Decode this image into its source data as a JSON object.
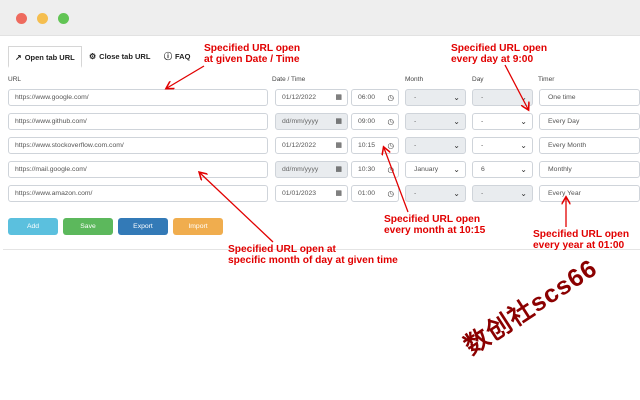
{
  "window": {
    "traffic_lights": [
      "#ee6a5e",
      "#f5be4f",
      "#61c454"
    ]
  },
  "tabs": [
    {
      "label": "Open tab URL",
      "icon": "external-link-icon",
      "active": true
    },
    {
      "label": "Close tab URL",
      "icon": "gear-icon",
      "active": false
    },
    {
      "label": "FAQ",
      "icon": "question-circle-icon",
      "active": false
    }
  ],
  "columns": {
    "url": "URL",
    "datetime": "Date / Time",
    "month": "Month",
    "day": "Day",
    "timer": "Timer"
  },
  "rows": [
    {
      "url": "https://www.google.com/",
      "date": "01/12/2022",
      "time": "06:00",
      "month": "-",
      "day": "-",
      "timer": "One time"
    },
    {
      "url": "https://www.github.com/",
      "date": "dd/mm/yyyy",
      "time": "09:00",
      "month": "-",
      "day": "-",
      "timer": "Every Day"
    },
    {
      "url": "https://www.stockoverflow.com.com/",
      "date": "01/12/2022",
      "time": "10:15",
      "month": "-",
      "day": "-",
      "timer": "Every Month"
    },
    {
      "url": "https://mail.google.com/",
      "date": "dd/mm/yyyy",
      "time": "10:30",
      "month": "January",
      "day": "6",
      "timer": "Monthly"
    },
    {
      "url": "https://www.amazon.com/",
      "date": "01/01/2023",
      "time": "01:00",
      "month": "-",
      "day": "-",
      "timer": "Every Year"
    }
  ],
  "buttons": [
    {
      "label": "Add",
      "color": "#5bc0de"
    },
    {
      "label": "Save",
      "color": "#5cb85c"
    },
    {
      "label": "Export",
      "color": "#337ab7"
    },
    {
      "label": "Import",
      "color": "#f0ad4e"
    }
  ],
  "annotations": {
    "a1": [
      "Specified URL open",
      "at given Date / Time"
    ],
    "a2": [
      "Specified URL open",
      "every day at 9:00"
    ],
    "a3": [
      "Specified URL open",
      "every month at 10:15"
    ],
    "a4": [
      "Specified URL open at",
      "specific month of day at given time"
    ],
    "a5": [
      "Specified URL open",
      "every year at 01:00"
    ],
    "color": "#e10000"
  },
  "watermark": "数创社scs66"
}
